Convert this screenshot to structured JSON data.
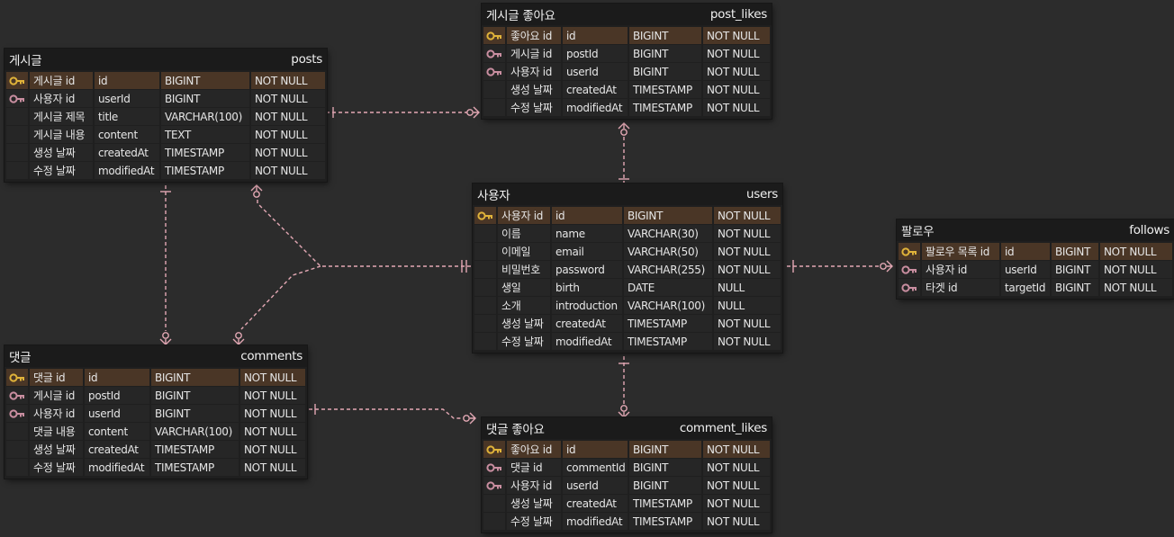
{
  "tables": [
    {
      "id": "posts",
      "title": "게시글",
      "name": "posts",
      "rows": [
        {
          "key": "pk",
          "label": "게시글 id",
          "column": "id",
          "type": "BIGINT",
          "constraint": "NOT NULL"
        },
        {
          "key": "fk",
          "label": "사용자 id",
          "column": "userId",
          "type": "BIGINT",
          "constraint": "NOT NULL"
        },
        {
          "key": "",
          "label": "게시글 제목",
          "column": "title",
          "type": "VARCHAR(100)",
          "constraint": "NOT NULL"
        },
        {
          "key": "",
          "label": "게시글 내용",
          "column": "content",
          "type": "TEXT",
          "constraint": "NOT NULL"
        },
        {
          "key": "",
          "label": "생성 날짜",
          "column": "createdAt",
          "type": "TIMESTAMP",
          "constraint": "NOT NULL"
        },
        {
          "key": "",
          "label": "수정 날짜",
          "column": "modifiedAt",
          "type": "TIMESTAMP",
          "constraint": "NOT NULL"
        }
      ]
    },
    {
      "id": "post_likes",
      "title": "게시글 좋아요",
      "name": "post_likes",
      "rows": [
        {
          "key": "pk",
          "label": "좋아요 id",
          "column": "id",
          "type": "BIGINT",
          "constraint": "NOT NULL"
        },
        {
          "key": "fk",
          "label": "게시글 id",
          "column": "postId",
          "type": "BIGINT",
          "constraint": "NOT NULL"
        },
        {
          "key": "fk",
          "label": "사용자 id",
          "column": "userId",
          "type": "BIGINT",
          "constraint": "NOT NULL"
        },
        {
          "key": "",
          "label": "생성 날짜",
          "column": "createdAt",
          "type": "TIMESTAMP",
          "constraint": "NOT NULL"
        },
        {
          "key": "",
          "label": "수정 날짜",
          "column": "modifiedAt",
          "type": "TIMESTAMP",
          "constraint": "NOT NULL"
        }
      ]
    },
    {
      "id": "users",
      "title": "사용자",
      "name": "users",
      "rows": [
        {
          "key": "pk",
          "label": "사용자 id",
          "column": "id",
          "type": "BIGINT",
          "constraint": "NOT NULL"
        },
        {
          "key": "",
          "label": "이름",
          "column": "name",
          "type": "VARCHAR(30)",
          "constraint": "NOT NULL"
        },
        {
          "key": "",
          "label": "이메일",
          "column": "email",
          "type": "VARCHAR(50)",
          "constraint": "NOT NULL"
        },
        {
          "key": "",
          "label": "비밀번호",
          "column": "password",
          "type": "VARCHAR(255)",
          "constraint": "NOT NULL"
        },
        {
          "key": "",
          "label": "생일",
          "column": "birth",
          "type": "DATE",
          "constraint": "NULL"
        },
        {
          "key": "",
          "label": "소개",
          "column": "introduction",
          "type": "VARCHAR(100)",
          "constraint": "NULL"
        },
        {
          "key": "",
          "label": "생성 날짜",
          "column": "createdAt",
          "type": "TIMESTAMP",
          "constraint": "NOT NULL"
        },
        {
          "key": "",
          "label": "수정 날짜",
          "column": "modifiedAt",
          "type": "TIMESTAMP",
          "constraint": "NOT NULL"
        }
      ]
    },
    {
      "id": "follows",
      "title": "팔로우",
      "name": "follows",
      "rows": [
        {
          "key": "pk",
          "label": "팔로우 목록 id",
          "column": "id",
          "type": "BIGINT",
          "constraint": "NOT NULL"
        },
        {
          "key": "fk",
          "label": "사용자 id",
          "column": "userId",
          "type": "BIGINT",
          "constraint": "NOT NULL"
        },
        {
          "key": "fk",
          "label": "타겟 id",
          "column": "targetId",
          "type": "BIGINT",
          "constraint": "NOT NULL"
        }
      ]
    },
    {
      "id": "comments",
      "title": "댓글",
      "name": "comments",
      "rows": [
        {
          "key": "pk",
          "label": "댓글 id",
          "column": "id",
          "type": "BIGINT",
          "constraint": "NOT NULL"
        },
        {
          "key": "fk",
          "label": "게시글 id",
          "column": "postId",
          "type": "BIGINT",
          "constraint": "NOT NULL"
        },
        {
          "key": "fk",
          "label": "사용자 id",
          "column": "userId",
          "type": "BIGINT",
          "constraint": "NOT NULL"
        },
        {
          "key": "",
          "label": "댓글 내용",
          "column": "content",
          "type": "VARCHAR(100)",
          "constraint": "NOT NULL"
        },
        {
          "key": "",
          "label": "생성 날짜",
          "column": "createdAt",
          "type": "TIMESTAMP",
          "constraint": "NOT NULL"
        },
        {
          "key": "",
          "label": "수정 날짜",
          "column": "modifiedAt",
          "type": "TIMESTAMP",
          "constraint": "NOT NULL"
        }
      ]
    },
    {
      "id": "comment_likes",
      "title": "댓글 좋아요",
      "name": "comment_likes",
      "rows": [
        {
          "key": "pk",
          "label": "좋아요 id",
          "column": "id",
          "type": "BIGINT",
          "constraint": "NOT NULL"
        },
        {
          "key": "fk",
          "label": "댓글 id",
          "column": "commentId",
          "type": "BIGINT",
          "constraint": "NOT NULL"
        },
        {
          "key": "fk",
          "label": "사용자 id",
          "column": "userId",
          "type": "BIGINT",
          "constraint": "NOT NULL"
        },
        {
          "key": "",
          "label": "생성 날짜",
          "column": "createdAt",
          "type": "TIMESTAMP",
          "constraint": "NOT NULL"
        },
        {
          "key": "",
          "label": "수정 날짜",
          "column": "modifiedAt",
          "type": "TIMESTAMP",
          "constraint": "NOT NULL"
        }
      ]
    }
  ],
  "relationships": [
    {
      "from": "posts",
      "to": "post_likes",
      "from_end": "one",
      "to_end": "zero-or-many"
    },
    {
      "from": "users",
      "to": "post_likes",
      "from_end": "one",
      "to_end": "zero-or-many"
    },
    {
      "from": "users",
      "to": "posts",
      "from_end": "one-and-only-one",
      "to_end": "zero-or-many"
    },
    {
      "from": "users",
      "to": "comments",
      "from_end": "one-and-only-one",
      "to_end": "zero-or-many"
    },
    {
      "from": "users",
      "to": "follows",
      "from_end": "one",
      "to_end": "zero-or-many"
    },
    {
      "from": "posts",
      "to": "comments",
      "from_end": "one",
      "to_end": "zero-or-many"
    },
    {
      "from": "comments",
      "to": "comment_likes",
      "from_end": "one",
      "to_end": "zero-or-many"
    },
    {
      "from": "users",
      "to": "comment_likes",
      "from_end": "one",
      "to_end": "zero-or-many"
    }
  ],
  "colors": {
    "background": "#2c2c2c",
    "table_body": "#1f1f1f",
    "cell": "#262626",
    "pk_row": "#4a3626",
    "pk_key_icon": "#e0b33a",
    "fk_key_icon": "#c98ea0",
    "relationship_line": "#e3a8b4",
    "text": "#e6e6e6"
  },
  "icons": {
    "pk": "gold-key-icon",
    "fk": "pink-key-icon"
  }
}
